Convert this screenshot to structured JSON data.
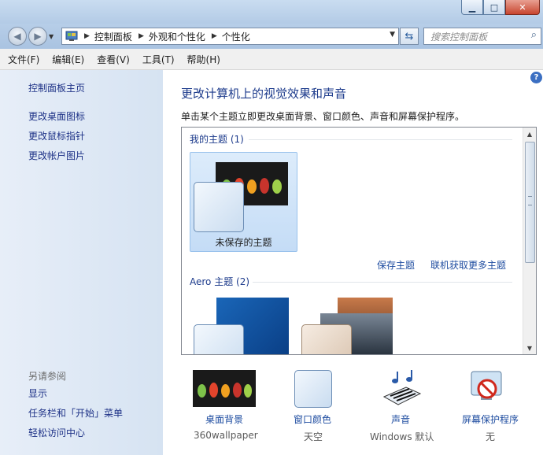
{
  "window": {
    "min_icon": "minimize-icon",
    "max_icon": "maximize-icon",
    "close_icon": "close-icon"
  },
  "address": {
    "breadcrumb": [
      "控制面板",
      "外观和个性化",
      "个性化"
    ],
    "search_placeholder": "搜索控制面板"
  },
  "menu": [
    "文件(F)",
    "编辑(E)",
    "查看(V)",
    "工具(T)",
    "帮助(H)"
  ],
  "sidebar": {
    "home": "控制面板主页",
    "links": [
      "更改桌面图标",
      "更改鼠标指针",
      "更改帐户图片"
    ],
    "see_also_title": "另请参阅",
    "see_also": [
      "显示",
      "任务栏和「开始」菜单",
      "轻松访问中心"
    ]
  },
  "main": {
    "title": "更改计算机上的视觉效果和声音",
    "description": "单击某个主题立即更改桌面背景、窗口颜色、声音和屏幕保护程序。",
    "my_themes_header": "我的主题 (1)",
    "unsaved_theme_label": "未保存的主题",
    "save_theme_link": "保存主题",
    "get_more_link": "联机获取更多主题",
    "aero_header": "Aero 主题 (2)"
  },
  "bottom": [
    {
      "label": "桌面背景",
      "value": "360wallpaper",
      "icon": "desktop-background-icon"
    },
    {
      "label": "窗口颜色",
      "value": "天空",
      "icon": "window-color-icon"
    },
    {
      "label": "声音",
      "value": "Windows 默认",
      "icon": "sound-icon"
    },
    {
      "label": "屏幕保护程序",
      "value": "无",
      "icon": "screensaver-icon"
    }
  ],
  "colors": {
    "link": "#1e4ca0",
    "sidebar_bg": "#dbe6f4",
    "heading": "#1d3b8c"
  }
}
